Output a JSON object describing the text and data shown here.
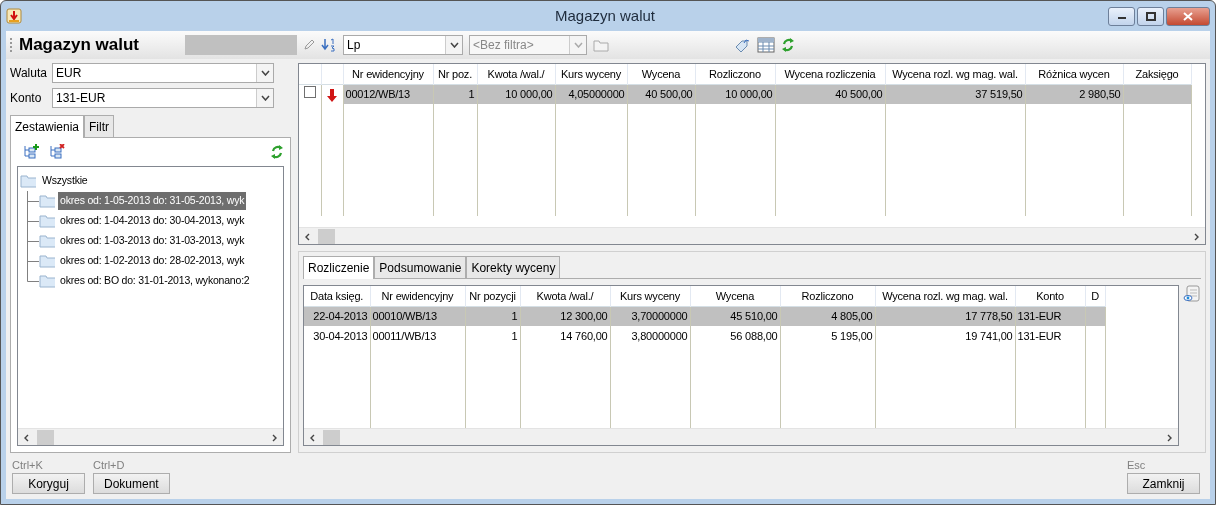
{
  "window": {
    "title": "Magazyn walut"
  },
  "toolbar": {
    "title": "Magazyn walut",
    "sort_value": "Lp",
    "filter_placeholder": "<Bez filtra>"
  },
  "fields": [
    {
      "label": "Waluta",
      "value": "EUR"
    },
    {
      "label": "Konto",
      "value": "131-EUR"
    }
  ],
  "left_tabs": [
    {
      "label": "Zestawienia",
      "selected": true
    },
    {
      "label": "Filtr",
      "selected": false
    }
  ],
  "tree": {
    "label": "Wszystkie",
    "children": [
      {
        "label": "okres od:  1-05-2013 do: 31-05-2013, wyk",
        "selected": true
      },
      {
        "label": "okres od:  1-04-2013 do: 30-04-2013, wyk",
        "selected": false
      },
      {
        "label": "okres od:  1-03-2013 do: 31-03-2013, wyk",
        "selected": false
      },
      {
        "label": "okres od:  1-02-2013 do: 28-02-2013, wyk",
        "selected": false
      },
      {
        "label": "okres od: BO do: 31-01-2013, wykonano:2",
        "selected": false
      }
    ]
  },
  "main_table": {
    "columns": [
      "Nr ewidencyjny",
      "Nr poz.",
      "Kwota /wal./",
      "Kurs wyceny",
      "Wycena",
      "Rozliczono",
      "Wycena rozliczenia",
      "Wycena rozl. wg mag. wal.",
      "Różnica wycen",
      "Zaksięgo"
    ],
    "rows": [
      {
        "checked": false,
        "selected": true,
        "cells": [
          "00012/WB/13",
          "1",
          "10 000,00",
          "4,05000000",
          "40 500,00",
          "10 000,00",
          "40 500,00",
          "37 519,50",
          "2 980,50",
          ""
        ]
      }
    ]
  },
  "bottom_tabs": [
    {
      "label": "Rozliczenie",
      "selected": true
    },
    {
      "label": "Podsumowanie",
      "selected": false
    },
    {
      "label": "Korekty wyceny",
      "selected": false
    }
  ],
  "bottom_table": {
    "columns": [
      "Data księg.",
      "Nr ewidencyjny",
      "Nr pozycji",
      "Kwota /wal./",
      "Kurs wyceny",
      "Wycena",
      "Rozliczono",
      "Wycena rozl. wg mag. wal.",
      "Konto",
      "D"
    ],
    "rows": [
      {
        "selected": true,
        "cells": [
          "22-04-2013",
          "00010/WB/13",
          "1",
          "12 300,00",
          "3,70000000",
          "45 510,00",
          "4 805,00",
          "17 778,50",
          "131-EUR",
          ""
        ]
      },
      {
        "selected": false,
        "cells": [
          "30-04-2013",
          "00011/WB/13",
          "1",
          "14 760,00",
          "3,80000000",
          "56 088,00",
          "5 195,00",
          "19 741,00",
          "131-EUR",
          ""
        ]
      }
    ]
  },
  "buttons": [
    {
      "shortcut": "Ctrl+K",
      "label": "Koryguj"
    },
    {
      "shortcut": "Ctrl+D",
      "label": "Dokument"
    },
    {
      "shortcut": "Esc",
      "label": "Zamknij"
    }
  ]
}
